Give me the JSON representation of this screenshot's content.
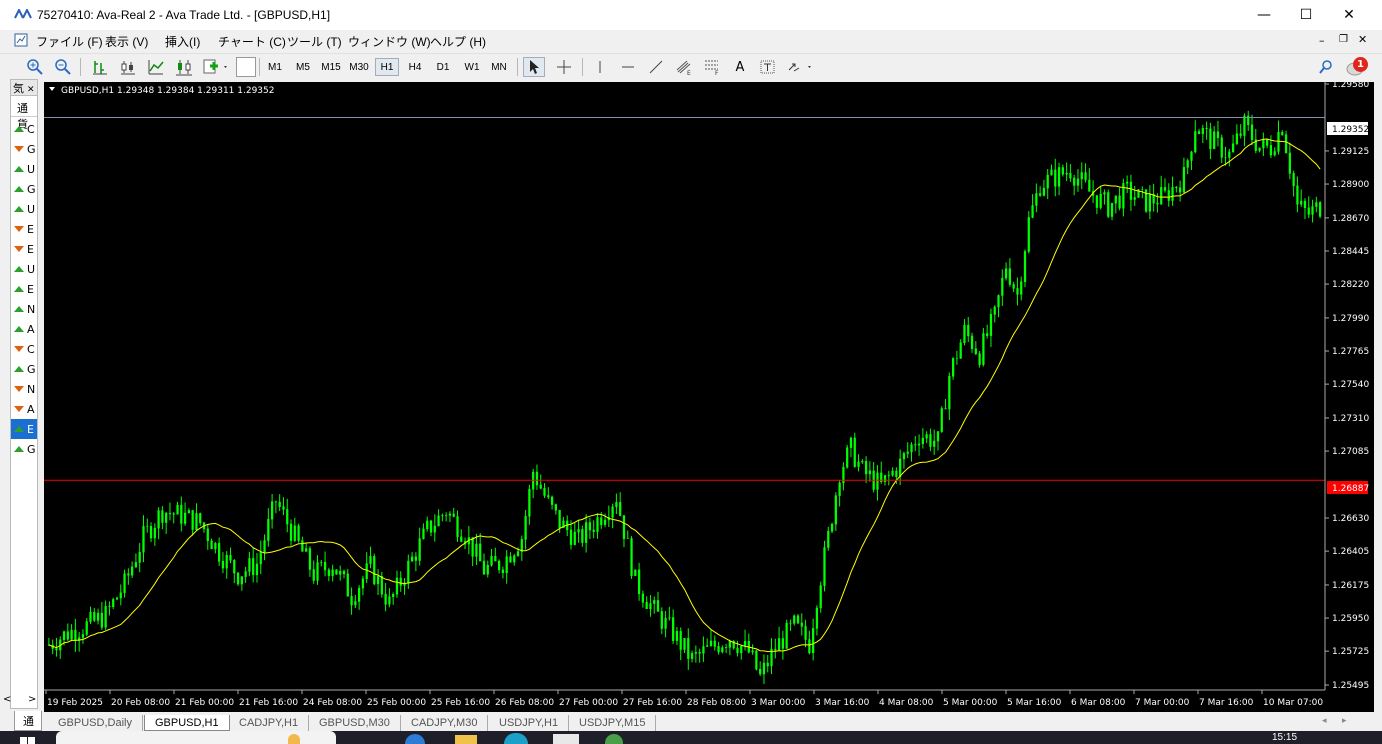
{
  "window": {
    "title": "75270410: Ava-Real 2 - Ava Trade Ltd. - [GBPUSD,H1]",
    "minimize": "—",
    "maximize": "☐",
    "close": "✕"
  },
  "menu": [
    "ファイル (F)",
    "表示 (V)",
    "挿入(I)",
    "チャート (C)",
    "ツール (T)",
    "ウィンドウ (W)",
    "ヘルプ (H)"
  ],
  "timeframes": [
    "M1",
    "M5",
    "M15",
    "M30",
    "H1",
    "H4",
    "D1",
    "W1",
    "MN"
  ],
  "active_timeframe": "H1",
  "notifications": {
    "count": "1"
  },
  "market_watch": {
    "header": "気",
    "column": "通貨",
    "items": [
      {
        "s": "C",
        "d": "up"
      },
      {
        "s": "G",
        "d": "down"
      },
      {
        "s": "U",
        "d": "up"
      },
      {
        "s": "G",
        "d": "up"
      },
      {
        "s": "U",
        "d": "up"
      },
      {
        "s": "E",
        "d": "down"
      },
      {
        "s": "E",
        "d": "down"
      },
      {
        "s": "U",
        "d": "up"
      },
      {
        "s": "E",
        "d": "up"
      },
      {
        "s": "N",
        "d": "up"
      },
      {
        "s": "A",
        "d": "up"
      },
      {
        "s": "C",
        "d": "down"
      },
      {
        "s": "G",
        "d": "up"
      },
      {
        "s": "N",
        "d": "down"
      },
      {
        "s": "A",
        "d": "down"
      },
      {
        "s": "E",
        "d": "up",
        "selected": true
      },
      {
        "s": "G",
        "d": "up"
      }
    ],
    "bottom_tab": "通"
  },
  "chart": {
    "header": "GBPUSD,H1  1.29348 1.29384 1.29311 1.29352",
    "current_price_label": "1.29352",
    "red_line_label": "1.26887"
  },
  "chart_data": {
    "type": "candlestick",
    "symbol": "GBPUSD",
    "timeframe": "H1",
    "ohlc": {
      "open": 1.29348,
      "high": 1.29384,
      "low": 1.29311,
      "close": 1.29352
    },
    "y_ticks": [
      "1.29580",
      "1.29125",
      "1.28900",
      "1.28670",
      "1.28445",
      "1.28220",
      "1.27990",
      "1.27765",
      "1.27540",
      "1.27310",
      "1.27085",
      "1.26630",
      "1.26405",
      "1.26175",
      "1.25950",
      "1.25725",
      "1.25495"
    ],
    "ylim": [
      1.25495,
      1.2958
    ],
    "x_ticks": [
      "19 Feb 2025",
      "20 Feb 08:00",
      "21 Feb 00:00",
      "21 Feb 16:00",
      "24 Feb 08:00",
      "25 Feb 00:00",
      "25 Feb 16:00",
      "26 Feb 08:00",
      "27 Feb 00:00",
      "27 Feb 16:00",
      "28 Feb 08:00",
      "3 Mar 00:00",
      "3 Mar 16:00",
      "4 Mar 08:00",
      "5 Mar 00:00",
      "5 Mar 16:00",
      "6 Mar 08:00",
      "7 Mar 00:00",
      "7 Mar 16:00",
      "10 Mar 07:00"
    ],
    "anchors": [
      [
        0,
        1.2577
      ],
      [
        5,
        1.2585
      ],
      [
        10,
        1.259
      ],
      [
        15,
        1.2597
      ],
      [
        20,
        1.2618
      ],
      [
        25,
        1.265
      ],
      [
        30,
        1.2668
      ],
      [
        35,
        1.2665
      ],
      [
        40,
        1.266
      ],
      [
        45,
        1.264
      ],
      [
        50,
        1.2625
      ],
      [
        55,
        1.2632
      ],
      [
        60,
        1.2675
      ],
      [
        65,
        1.265
      ],
      [
        70,
        1.2625
      ],
      [
        75,
        1.2632
      ],
      [
        80,
        1.261
      ],
      [
        85,
        1.263
      ],
      [
        90,
        1.2605
      ],
      [
        95,
        1.263
      ],
      [
        100,
        1.2655
      ],
      [
        105,
        1.2668
      ],
      [
        110,
        1.2652
      ],
      [
        115,
        1.2628
      ],
      [
        120,
        1.2633
      ],
      [
        125,
        1.265
      ],
      [
        128,
        1.2695
      ],
      [
        132,
        1.2673
      ],
      [
        135,
        1.266
      ],
      [
        140,
        1.2648
      ],
      [
        145,
        1.2662
      ],
      [
        150,
        1.2678
      ],
      [
        152,
        1.2655
      ],
      [
        155,
        1.262
      ],
      [
        160,
        1.26
      ],
      [
        165,
        1.2585
      ],
      [
        170,
        1.2567
      ],
      [
        175,
        1.2575
      ],
      [
        180,
        1.2582
      ],
      [
        185,
        1.2572
      ],
      [
        188,
        1.2555
      ],
      [
        192,
        1.2575
      ],
      [
        197,
        1.259
      ],
      [
        201,
        1.2578
      ],
      [
        203,
        1.261
      ],
      [
        206,
        1.265
      ],
      [
        209,
        1.2695
      ],
      [
        212,
        1.271
      ],
      [
        215,
        1.2695
      ],
      [
        220,
        1.2685
      ],
      [
        225,
        1.27
      ],
      [
        230,
        1.272
      ],
      [
        235,
        1.2715
      ],
      [
        238,
        1.276
      ],
      [
        242,
        1.279
      ],
      [
        246,
        1.2775
      ],
      [
        250,
        1.28
      ],
      [
        253,
        1.2835
      ],
      [
        256,
        1.2815
      ],
      [
        259,
        1.2865
      ],
      [
        262,
        1.289
      ],
      [
        266,
        1.2895
      ],
      [
        270,
        1.29
      ],
      [
        275,
        1.2885
      ],
      [
        280,
        1.2875
      ],
      [
        285,
        1.2885
      ],
      [
        290,
        1.2878
      ],
      [
        295,
        1.2882
      ],
      [
        300,
        1.2895
      ],
      [
        303,
        1.293
      ],
      [
        308,
        1.2918
      ],
      [
        312,
        1.291
      ],
      [
        316,
        1.293
      ],
      [
        320,
        1.2915
      ],
      [
        323,
        1.2915
      ],
      [
        326,
        1.293
      ],
      [
        330,
        1.2875
      ],
      [
        333,
        1.287
      ],
      [
        336,
        1.2875
      ]
    ],
    "ma_period": 20,
    "colors": {
      "candle": "#00ff00",
      "ma": "#ffff00",
      "bid_line": "#8090a8",
      "red_line": "#ff0000",
      "bg": "#000000",
      "axis_text": "#ffffff"
    },
    "grid": false
  },
  "tabs": [
    "GBPUSD,Daily",
    "GBPUSD,H1",
    "CADJPY,H1",
    "GBPUSD,M30",
    "CADJPY,M30",
    "USDJPY,H1",
    "USDJPY,M15"
  ],
  "active_tab": "GBPUSD,H1",
  "taskbar": {
    "time": "15:15"
  }
}
